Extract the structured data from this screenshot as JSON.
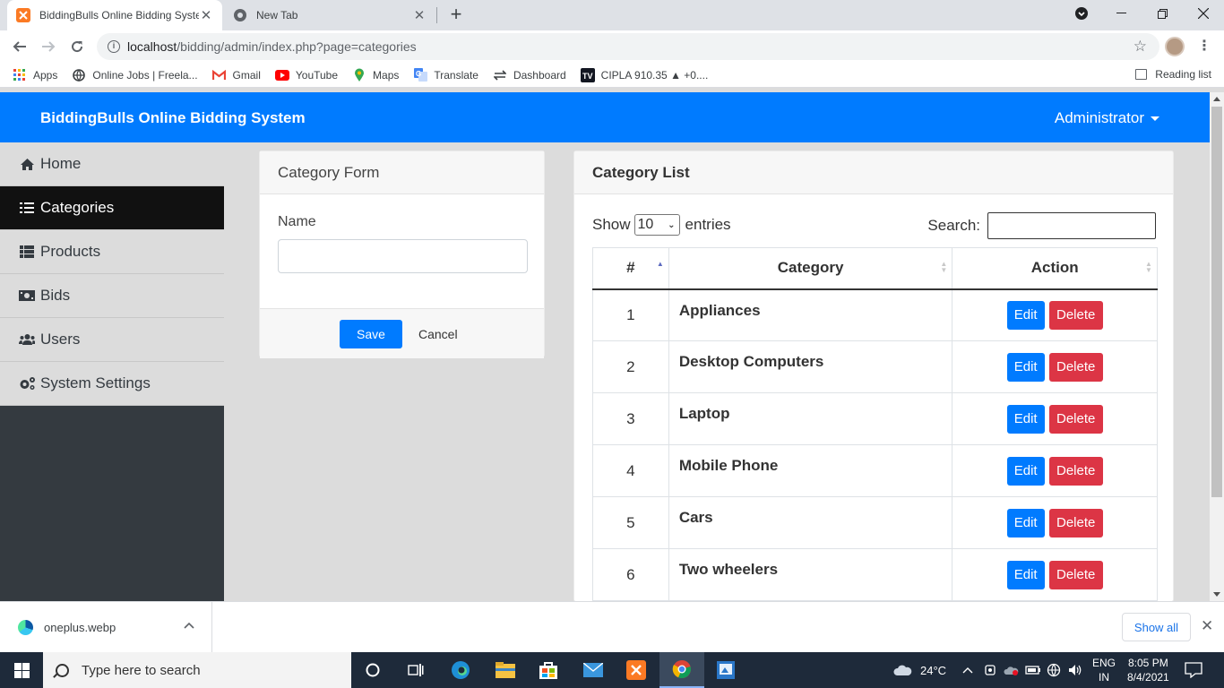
{
  "browser": {
    "tabs": [
      {
        "title": "BiddingBulls Online Bidding System",
        "active": true
      },
      {
        "title": "New Tab",
        "active": false
      }
    ],
    "url_host": "localhost",
    "url_path": "/bidding/admin/index.php?page=categories",
    "bookmarks": [
      {
        "label": "Apps",
        "icon": "apps-grid-icon"
      },
      {
        "label": "Online Jobs | Freela...",
        "icon": "globe-icon"
      },
      {
        "label": "Gmail",
        "icon": "gmail-icon"
      },
      {
        "label": "YouTube",
        "icon": "youtube-icon"
      },
      {
        "label": "Maps",
        "icon": "maps-pin-icon"
      },
      {
        "label": "Translate",
        "icon": "translate-icon"
      },
      {
        "label": "Dashboard",
        "icon": "dashboard-icon"
      },
      {
        "label": "CIPLA 910.35 ▲ +0....",
        "icon": "tradingview-icon"
      }
    ],
    "reading_list": "Reading list"
  },
  "app": {
    "brand": "BiddingBulls Online Bidding System",
    "user_menu": "Administrator",
    "accent": "#007bff"
  },
  "sidebar": {
    "items": [
      {
        "label": "Home",
        "icon": "home-icon",
        "active": false
      },
      {
        "label": "Categories",
        "icon": "list-icon",
        "active": true
      },
      {
        "label": "Products",
        "icon": "th-list-icon",
        "active": false
      },
      {
        "label": "Bids",
        "icon": "money-bill-icon",
        "active": false
      },
      {
        "label": "Users",
        "icon": "users-icon",
        "active": false
      },
      {
        "label": "System Settings",
        "icon": "cogs-icon",
        "active": false
      }
    ]
  },
  "form": {
    "title": "Category Form",
    "name_label": "Name",
    "name_value": "",
    "save": "Save",
    "cancel": "Cancel"
  },
  "list": {
    "title": "Category List",
    "show": "Show",
    "entries_value": "10",
    "entries": "entries",
    "search_label": "Search:",
    "search_value": "",
    "columns": [
      "#",
      "Category",
      "Action"
    ],
    "rows": [
      {
        "num": "1",
        "category": "Appliances"
      },
      {
        "num": "2",
        "category": "Desktop Computers"
      },
      {
        "num": "3",
        "category": "Laptop"
      },
      {
        "num": "4",
        "category": "Mobile Phone"
      },
      {
        "num": "5",
        "category": "Cars"
      },
      {
        "num": "6",
        "category": "Two wheelers"
      }
    ],
    "edit": "Edit",
    "delete": "Delete"
  },
  "download": {
    "file": "oneplus.webp",
    "show_all": "Show all"
  },
  "taskbar": {
    "search_placeholder": "Type here to search",
    "weather": "24°C",
    "lang_line1": "ENG",
    "lang_line2": "IN",
    "time": "8:05 PM",
    "date": "8/4/2021"
  }
}
